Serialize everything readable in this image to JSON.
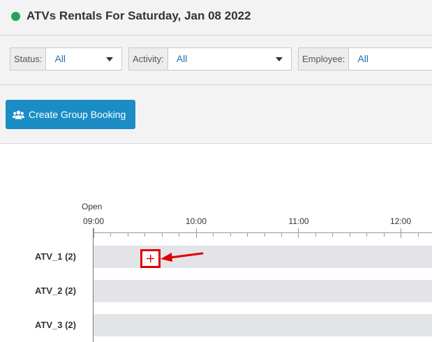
{
  "header": {
    "title": "ATVs Rentals For Saturday, Jan 08 2022",
    "status_color": "#1fa55b"
  },
  "filters": {
    "status": {
      "label": "Status:",
      "value": "All"
    },
    "activity": {
      "label": "Activity:",
      "value": "All"
    },
    "employee": {
      "label": "Employee:",
      "value": "All"
    }
  },
  "actions": {
    "create_group_booking": {
      "label": "Create Group Booking",
      "icon": "users-icon"
    }
  },
  "timeline": {
    "open_label": "Open",
    "time_labels": [
      "09:00",
      "10:00",
      "11:00",
      "12:00"
    ],
    "rows": [
      {
        "label": "ATV_1 (2)"
      },
      {
        "label": "ATV_2 (2)"
      },
      {
        "label": "ATV_3 (2)"
      }
    ],
    "add_booking_icon": "plus-icon",
    "highlight_color": "#e00000"
  }
}
